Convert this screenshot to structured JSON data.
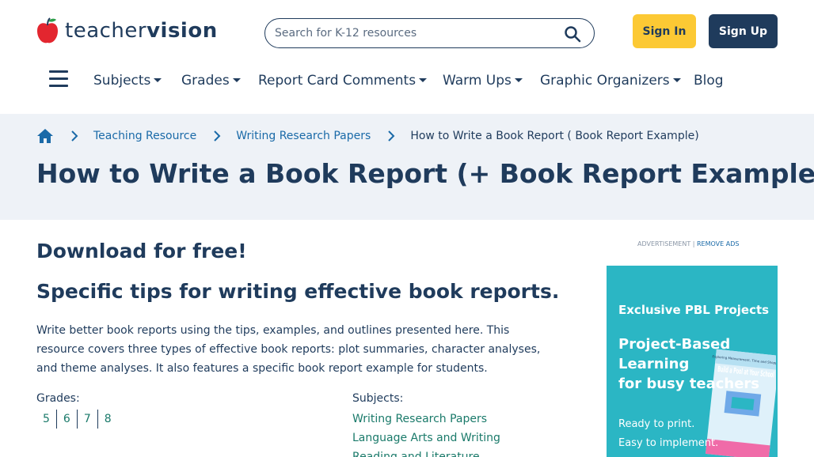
{
  "logo": {
    "part1": "teacher",
    "part2": "vision"
  },
  "search": {
    "placeholder": "Search for K-12 resources"
  },
  "auth": {
    "signin": "Sign In",
    "signup": "Sign Up"
  },
  "nav": {
    "items": [
      {
        "label": "Subjects",
        "dropdown": true
      },
      {
        "label": "Grades",
        "dropdown": true
      },
      {
        "label": "Report Card Comments",
        "dropdown": true
      },
      {
        "label": "Warm Ups",
        "dropdown": true
      },
      {
        "label": "Graphic Organizers",
        "dropdown": true
      },
      {
        "label": "Blog",
        "dropdown": false
      }
    ]
  },
  "breadcrumb": {
    "items": [
      "Teaching Resource",
      "Writing Research Papers",
      "How to Write a Book Report ( Book Report Example)"
    ]
  },
  "page": {
    "title": "How to Write a Book Report (+ Book Report Example)",
    "download": "Download for free!",
    "subtitle": "Specific tips for writing effective book reports.",
    "description": "Write better book reports using the tips, examples, and outlines presented here. This resource covers three types of effective book reports: plot summaries, character analyses, and theme analyses. It also features a specific book report example for students.",
    "grades_label": "Grades:",
    "grades": [
      "5",
      "6",
      "7",
      "8"
    ],
    "subjects_label": "Subjects:",
    "subjects": [
      "Writing Research Papers",
      "Language Arts and Writing",
      "Reading and Literature"
    ]
  },
  "ad": {
    "label": "ADVERTISEMENT |",
    "remove": "REMOVE ADS",
    "heading": "Exclusive PBL Projects",
    "title_line1": "Project-Based",
    "title_line2": "Learning",
    "title_line3": "for busy teachers",
    "line1": "Ready to print.",
    "line2": "Easy to implement.",
    "book_title": "Build a Pool at Your School",
    "book_top": "Exploring Measurement, Time and Shopping"
  },
  "colors": {
    "navy": "#1f3b5c",
    "yellow": "#fcc934",
    "link": "#1a6aa8",
    "green": "#1a7a6a",
    "banner": "#eef2f7",
    "ad": "#2bb6c4",
    "apple": "#e3262f"
  }
}
